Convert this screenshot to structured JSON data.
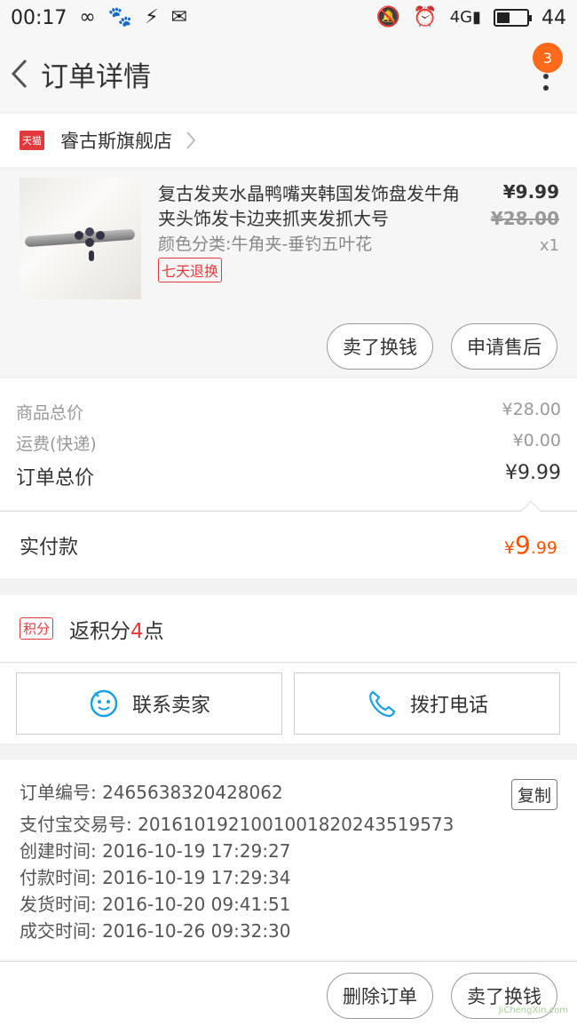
{
  "status_bar": {
    "time": "00:17",
    "left_icons": [
      "infinity-icon",
      "baidu-paw-icon",
      "flash-icon",
      "mail-icon"
    ],
    "right_icons": [
      "mute-icon",
      "alarm-icon",
      "signal-4g-icon"
    ],
    "battery_level": 0.44,
    "battery_text": "44"
  },
  "header": {
    "title": "订单详情",
    "badge_count": "3"
  },
  "shop": {
    "badge": "天猫",
    "name": "睿古斯旗舰店"
  },
  "product": {
    "title": "复古发夹水晶鸭嘴夹韩国发饰盘发牛角夹头饰发卡边夹抓夹发抓大号",
    "spec": "颜色分类:牛角夹-垂钓五叶花",
    "tag": "七天退换",
    "price": "¥9.99",
    "original_price": "¥28.00",
    "quantity": "x1",
    "sell_button": "卖了换钱",
    "aftersale_button": "申请售后"
  },
  "totals": {
    "goods_label": "商品总价",
    "goods_value": "¥28.00",
    "shipping_label": "运费(快递)",
    "shipping_value": "¥0.00",
    "order_label": "订单总价",
    "order_value": "¥9.99"
  },
  "paid": {
    "label": "实付款",
    "currency": "¥",
    "integer": "9",
    "decimal": ".99"
  },
  "points": {
    "tag": "积分",
    "prefix": "返积分",
    "count": "4",
    "suffix": "点"
  },
  "contact": {
    "seller_label": "联系卖家",
    "phone_label": "拨打电话"
  },
  "order_info": {
    "order_no": "订单编号: 2465638320428062",
    "alipay_no": "支付宝交易号: 2016101921001001820243519573",
    "created": "创建时间: 2016-10-19 17:29:27",
    "paid": "付款时间: 2016-10-19 17:29:34",
    "shipped": "发货时间: 2016-10-20 09:41:51",
    "completed": "成交时间: 2016-10-26 09:32:30",
    "copy_label": "复制"
  },
  "footer": {
    "delete_button": "删除订单",
    "sell_button": "卖了换钱"
  },
  "watermark": "JiChengXin.com",
  "colors": {
    "accent_red": "#e4393c",
    "price_orange": "#ff5000",
    "badge_orange": "#ff6a1a",
    "contact_blue": "#1ba0e1"
  }
}
